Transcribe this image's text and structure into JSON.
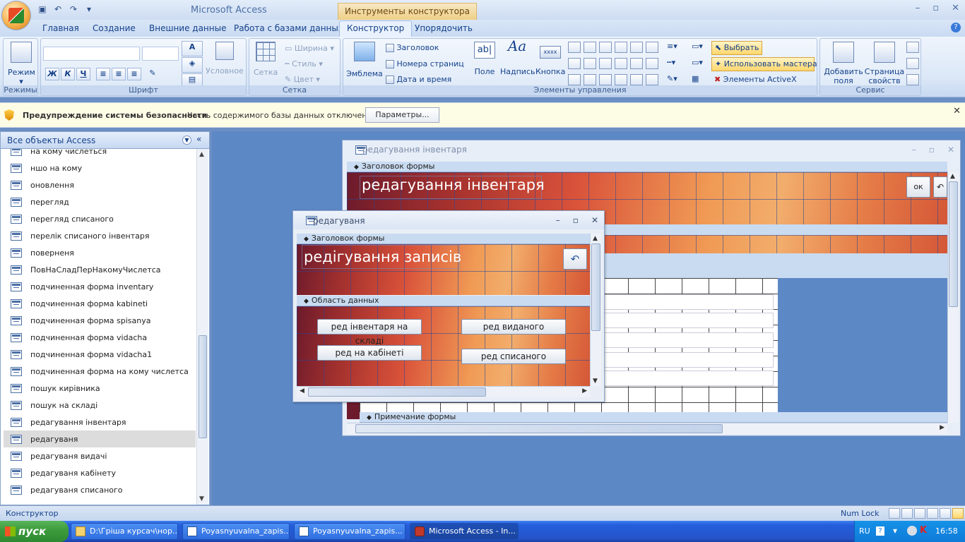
{
  "app": {
    "title": "Microsoft Access",
    "context_title": "Инструменты конструктора форм"
  },
  "tabs": [
    "Главная",
    "Создание",
    "Внешние данные",
    "Работа с базами данных",
    "Конструктор",
    "Упорядочить"
  ],
  "ribbon": {
    "modes": {
      "label": "Режим",
      "group": "Режимы"
    },
    "font": {
      "group": "Шрифт",
      "bold": "Ж",
      "italic": "К",
      "underline": "Ч",
      "conditional": "Условное"
    },
    "grid": {
      "group": "Сетка",
      "label": "Сетка",
      "width": "Ширина",
      "style": "Стиль",
      "color": "Цвет"
    },
    "controls": {
      "group": "Элементы управления",
      "logo": "Эмблема",
      "header": "Заголовок",
      "page_numbers": "Номера страниц",
      "date_time": "Дата и время",
      "field": "Поле",
      "label": "Надпись",
      "button": "Кнопка",
      "select": "Выбрать",
      "wizard": "Использовать мастера",
      "activex": "Элементы ActiveX"
    },
    "service": {
      "group": "Сервис",
      "add_fields": "Добавить поля",
      "property_sheet": "Страница свойств"
    }
  },
  "security": {
    "title": "Предупреждение системы безопасности",
    "message": "Часть содержимого базы данных отключено",
    "button": "Параметры..."
  },
  "nav": {
    "title": "Все объекты Access",
    "items": [
      "на кому числеться",
      "ншо на кому",
      "оновлення",
      "перегляд",
      "перегляд списаного",
      "перелік списаного інвентаря",
      "поверненя",
      "ПовНаСладПерНакомуЧислетса",
      "подчиненная форма inventary",
      "подчиненная форма kabineti",
      "подчиненная форма spisanya",
      "подчиненная форма vidacha",
      "подчиненная форма vidacha1",
      "подчиненная форма на кому числетса",
      "пошук кирівника",
      "пошук на складі",
      "редагування інвентаря",
      "редагуваня",
      "редагуваня видачі",
      "редагуваня кабінету",
      "редагуваня списаного"
    ],
    "selected": "редагуваня"
  },
  "window_back": {
    "title": "редагування інвентаря",
    "section_header": "Заголовок формы",
    "form_title": "редагування інвентаря",
    "ok_button": "ок",
    "section_footer": "Примечание формы"
  },
  "window_front": {
    "title": "редагуваня",
    "section_header": "Заголовок формы",
    "form_title": "редігування записів",
    "section_data": "Область данных",
    "buttons": [
      "ред інвентаря на складі",
      "ред виданого",
      "ред на кабінеті",
      "ред списаного"
    ]
  },
  "status": {
    "left": "Конструктор",
    "numlock": "Num Lock"
  },
  "taskbar": {
    "start": "пуск",
    "tasks": [
      "D:\\Гріша курсач\\нор...",
      "Poyasnyuvalna_zapis...",
      "Poyasnyuvalna_zapis...",
      "Microsoft Access - In..."
    ],
    "lang": "RU",
    "clock": "16:58"
  },
  "colors": {
    "ribbon_bg": "#dbe7f7",
    "workspace": "#5d88c6",
    "taskbar": "#245edb",
    "start": "#3c9a3c"
  }
}
